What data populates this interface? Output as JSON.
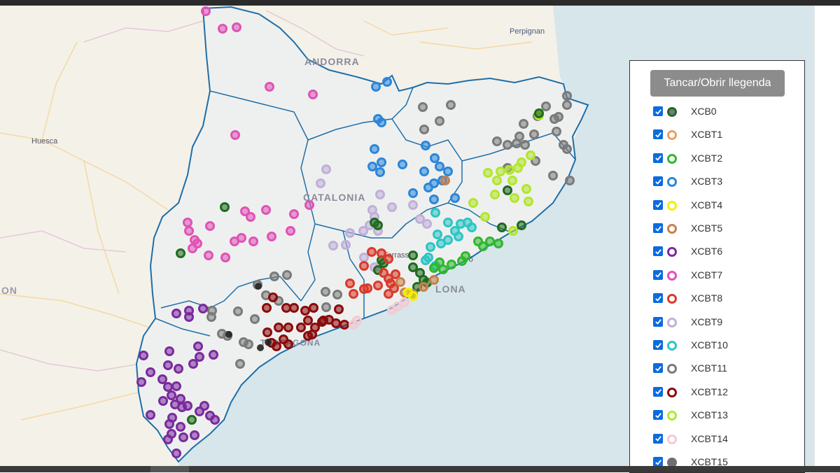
{
  "map": {
    "labels": {
      "perpignan": "Perpignan",
      "andorra": "ANDORRA",
      "huesca": "Huesca",
      "catalonia": "CATALONIA",
      "terrassa": "Terrass",
      "mataro": "ró",
      "barcelona": "LONA",
      "tarragona": "TARRAGONA",
      "aragon": "ON"
    },
    "colors": {
      "land": "#f4f1e9",
      "sea": "#d6e6ea",
      "catalonia": "#eef0ef",
      "border": "#1f6ea8",
      "roads": "#f3d9a4"
    }
  },
  "legend": {
    "toggle_label": "Tancar/Obrir llegenda",
    "items": [
      {
        "name": "XCB0",
        "color": "#1f6b1f",
        "checked": true
      },
      {
        "name": "XCBT1",
        "color": "#e8a066",
        "checked": true
      },
      {
        "name": "XCBT2",
        "color": "#2eb82e",
        "checked": true
      },
      {
        "name": "XCBT3",
        "color": "#2b86d9",
        "checked": true
      },
      {
        "name": "XCBT4",
        "color": "#f2f200",
        "checked": true
      },
      {
        "name": "XCBT5",
        "color": "#c8804a",
        "checked": true
      },
      {
        "name": "XCBT6",
        "color": "#7a2a9e",
        "checked": true
      },
      {
        "name": "XCBT7",
        "color": "#e052b5",
        "checked": true
      },
      {
        "name": "XCBT8",
        "color": "#d93a2b",
        "checked": true
      },
      {
        "name": "XCBT9",
        "color": "#c0b0d8",
        "checked": true
      },
      {
        "name": "XCBT10",
        "color": "#2ec4c4",
        "checked": true
      },
      {
        "name": "XCBT11",
        "color": "#7a7a7a",
        "checked": true
      },
      {
        "name": "XCBT12",
        "color": "#8b0a0a",
        "checked": true
      },
      {
        "name": "XCBT13",
        "color": "#b3e62e",
        "checked": true
      },
      {
        "name": "XCBT14",
        "color": "#f5c9d0",
        "checked": true
      },
      {
        "name": "XCBT15",
        "color": "#707070",
        "checked": true
      }
    ]
  }
}
